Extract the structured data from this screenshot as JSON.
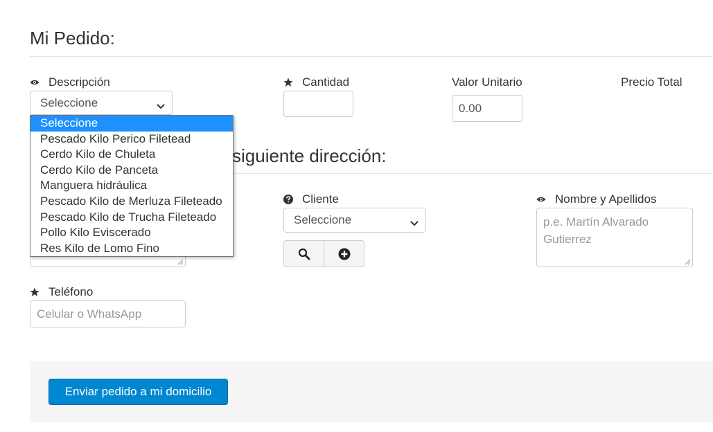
{
  "order": {
    "heading": "Mi Pedido:",
    "fields": {
      "descripcion": {
        "label": "Descripción",
        "selected": "Seleccione"
      },
      "cantidad": {
        "label": "Cantidad",
        "value": ""
      },
      "valor_unitario": {
        "label": "Valor Unitario",
        "value": "0.00"
      },
      "precio_total": {
        "label": "Precio Total"
      }
    },
    "dropdown_options": [
      "Seleccione",
      "Pescado Kilo Perico Filetead",
      "Cerdo Kilo de Chuleta",
      "Cerdo Kilo de Panceta",
      "Manguera hidráulica",
      "Pescado Kilo de Merluza Fileteado",
      "Pescado Kilo de Trucha Fileteado",
      "Pollo Kilo Eviscerado",
      "Res Kilo de Lomo Fino"
    ],
    "highlighted_option_index": 0
  },
  "delivery": {
    "heading": "siguiente dirección:",
    "cliente": {
      "label": "Cliente",
      "selected": "Seleccione"
    },
    "nombre": {
      "label": "Nombre y Apellidos",
      "placeholder": "p.e. Martín Alvarado Gutierrez"
    },
    "telefono": {
      "label": "Teléfono",
      "placeholder": "Celular o WhatsApp"
    }
  },
  "footer": {
    "submit_label": "Enviar pedido a mi domicilio"
  },
  "colors": {
    "primary": "#0087d1",
    "highlight": "#1e90ff",
    "footer_bg": "#f5f5f5"
  },
  "icons": {
    "descripcion": "eye-icon",
    "cantidad": "star-icon",
    "cliente": "question-circle-icon",
    "nombre": "eye-icon",
    "telefono": "star-icon",
    "search": "search-icon",
    "add": "plus-circle-icon"
  }
}
